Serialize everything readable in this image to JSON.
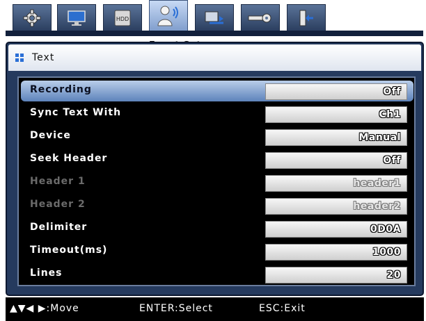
{
  "tabs": [
    {
      "icon": "gear-icon",
      "active": false
    },
    {
      "icon": "monitor-icon",
      "active": false
    },
    {
      "icon": "hdd-icon",
      "label": "HDD",
      "active": false
    },
    {
      "icon": "user-alarm-icon",
      "active": true
    },
    {
      "icon": "network-icon",
      "active": false
    },
    {
      "icon": "device-settings-icon",
      "active": false
    },
    {
      "icon": "exit-icon",
      "active": false
    }
  ],
  "background_title": "Event Setup",
  "panel": {
    "title": "Text",
    "rows": [
      {
        "label": "Recording",
        "value": "Off",
        "selected": true,
        "enabled": true
      },
      {
        "label": "Sync Text With",
        "value": "Ch1",
        "selected": false,
        "enabled": true
      },
      {
        "label": "Device",
        "value": "Manual",
        "selected": false,
        "enabled": true
      },
      {
        "label": "Seek Header",
        "value": "Off",
        "selected": false,
        "enabled": true
      },
      {
        "label": "Header 1",
        "value": "header1",
        "selected": false,
        "enabled": false
      },
      {
        "label": "Header 2",
        "value": "header2",
        "selected": false,
        "enabled": false
      },
      {
        "label": "Delimiter",
        "value": "0D0A",
        "selected": false,
        "enabled": true
      },
      {
        "label": "Timeout(ms)",
        "value": "1000",
        "selected": false,
        "enabled": true
      },
      {
        "label": "Lines",
        "value": "20",
        "selected": false,
        "enabled": true
      }
    ]
  },
  "status_bar": {
    "move": "▲▼◀ ▶:Move",
    "select": "ENTER:Select",
    "exit": "ESC:Exit"
  },
  "colors": {
    "panel_bg": "#253a5e",
    "selection": "#5d83bb",
    "list_bg": "#000000"
  }
}
